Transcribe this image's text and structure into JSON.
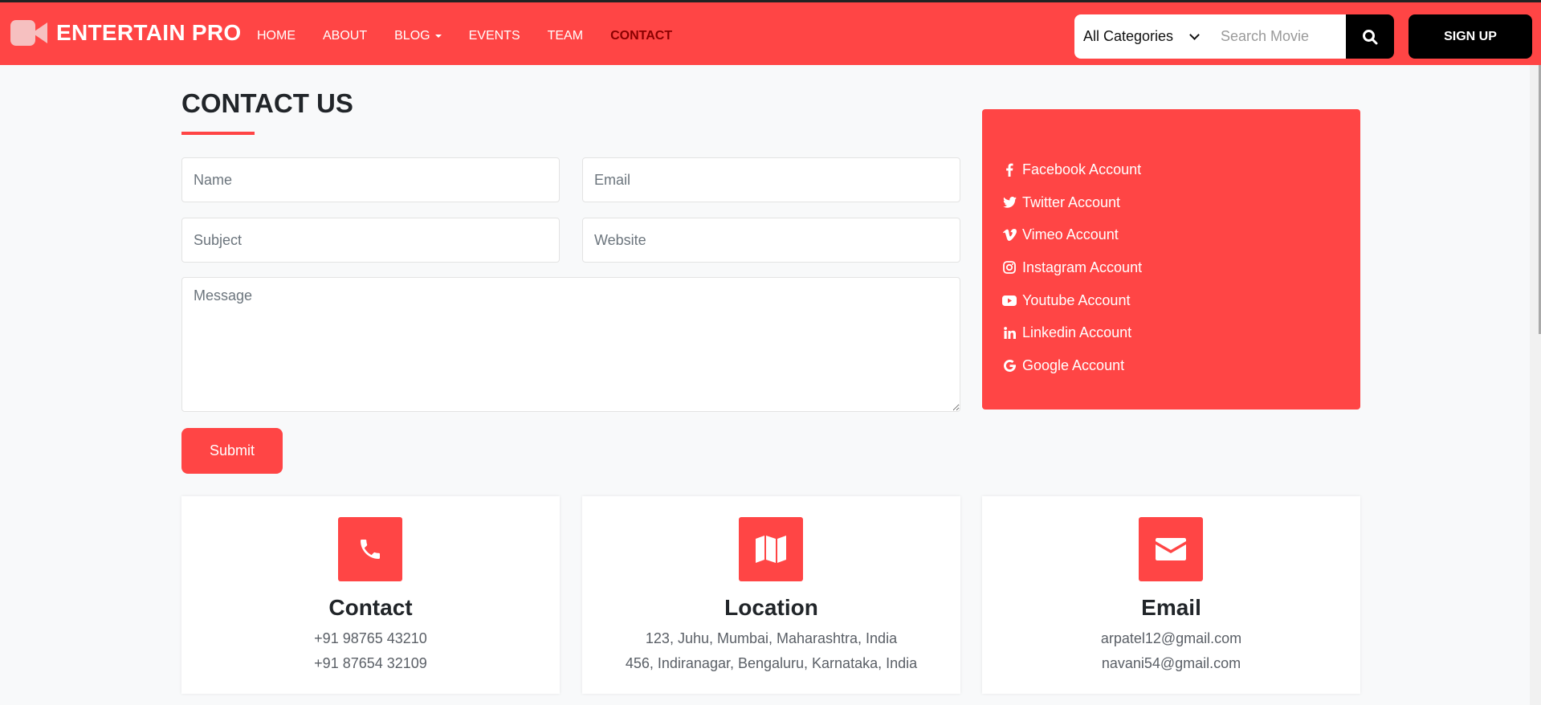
{
  "brand": {
    "name": "ENTERTAIN PRO",
    "icon": "video-camera-icon"
  },
  "nav": {
    "items": [
      "HOME",
      "ABOUT",
      "BLOG",
      "EVENTS",
      "TEAM",
      "CONTACT"
    ],
    "active": "CONTACT",
    "dropdown_item": "BLOG"
  },
  "search": {
    "category": "All Categories",
    "placeholder": "Search Movie",
    "icon": "search-icon"
  },
  "signup_label": "SIGN UP",
  "contact": {
    "title": "CONTACT US",
    "form": {
      "name_placeholder": "Name",
      "email_placeholder": "Email",
      "subject_placeholder": "Subject",
      "website_placeholder": "Website",
      "message_placeholder": "Message",
      "submit_label": "Submit"
    }
  },
  "social": [
    {
      "icon": "facebook-icon",
      "label": "Facebook Account"
    },
    {
      "icon": "twitter-icon",
      "label": "Twitter Account"
    },
    {
      "icon": "vimeo-icon",
      "label": "Vimeo Account"
    },
    {
      "icon": "instagram-icon",
      "label": "Instagram Account"
    },
    {
      "icon": "youtube-icon",
      "label": "Youtube Account"
    },
    {
      "icon": "linkedin-icon",
      "label": "Linkedin Account"
    },
    {
      "icon": "google-icon",
      "label": "Google Account"
    }
  ],
  "cards": [
    {
      "icon": "phone-icon",
      "title": "Contact",
      "lines": [
        "+91 98765 43210",
        "+91 87654 32109"
      ]
    },
    {
      "icon": "map-icon",
      "title": "Location",
      "lines": [
        "123, Juhu, Mumbai, Maharashtra, India",
        "456, Indiranagar, Bengaluru, Karnataka, India"
      ]
    },
    {
      "icon": "envelope-icon",
      "title": "Email",
      "lines": [
        "arpatel12@gmail.com",
        "navani54@gmail.com"
      ]
    }
  ],
  "colors": {
    "accent": "#ff4545",
    "active_nav": "#8a0000",
    "dark": "#000000",
    "background": "#f8f9fa"
  }
}
